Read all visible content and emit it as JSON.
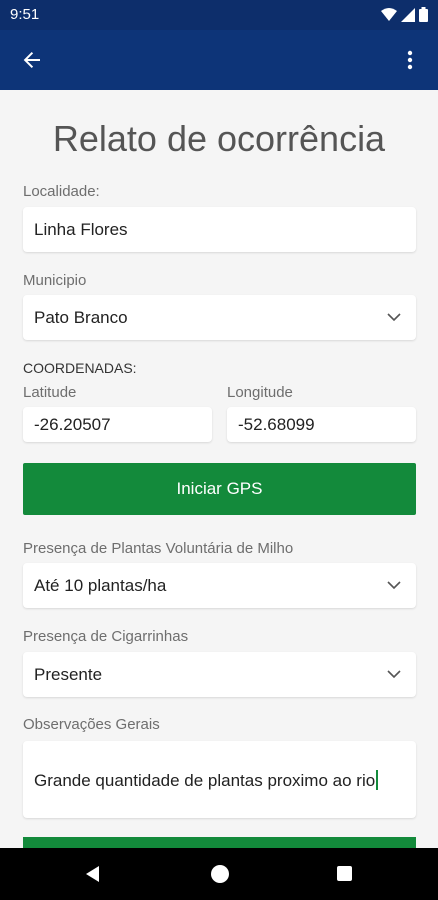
{
  "status_bar": {
    "time": "9:51"
  },
  "app_bar": {
    "back_icon": "arrow-left-icon",
    "menu_icon": "more-vert-icon"
  },
  "page": {
    "title": "Relato de ocorrência"
  },
  "form": {
    "localidade": {
      "label": "Localidade:",
      "value": "Linha Flores"
    },
    "municipio": {
      "label": "Municipio",
      "value": "Pato Branco"
    },
    "coordenadas": {
      "label": "COORDENADAS:",
      "latitude": {
        "label": "Latitude",
        "value": "-26.20507"
      },
      "longitude": {
        "label": "Longitude",
        "value": "-52.68099"
      }
    },
    "gps_button": "Iniciar GPS",
    "plantas": {
      "label": "Presença de Plantas Voluntária de Milho",
      "value": "Até 10 plantas/ha"
    },
    "cigarrinhas": {
      "label": "Presença de Cigarrinhas",
      "value": "Presente"
    },
    "observacoes": {
      "label": "Observações Gerais",
      "value": "Grande quantidade de plantas proximo ao rio"
    }
  },
  "colors": {
    "status_bar": "#0d2e6b",
    "app_bar": "#0d3478",
    "accent": "#138a3b",
    "background": "#f5f5f5"
  }
}
